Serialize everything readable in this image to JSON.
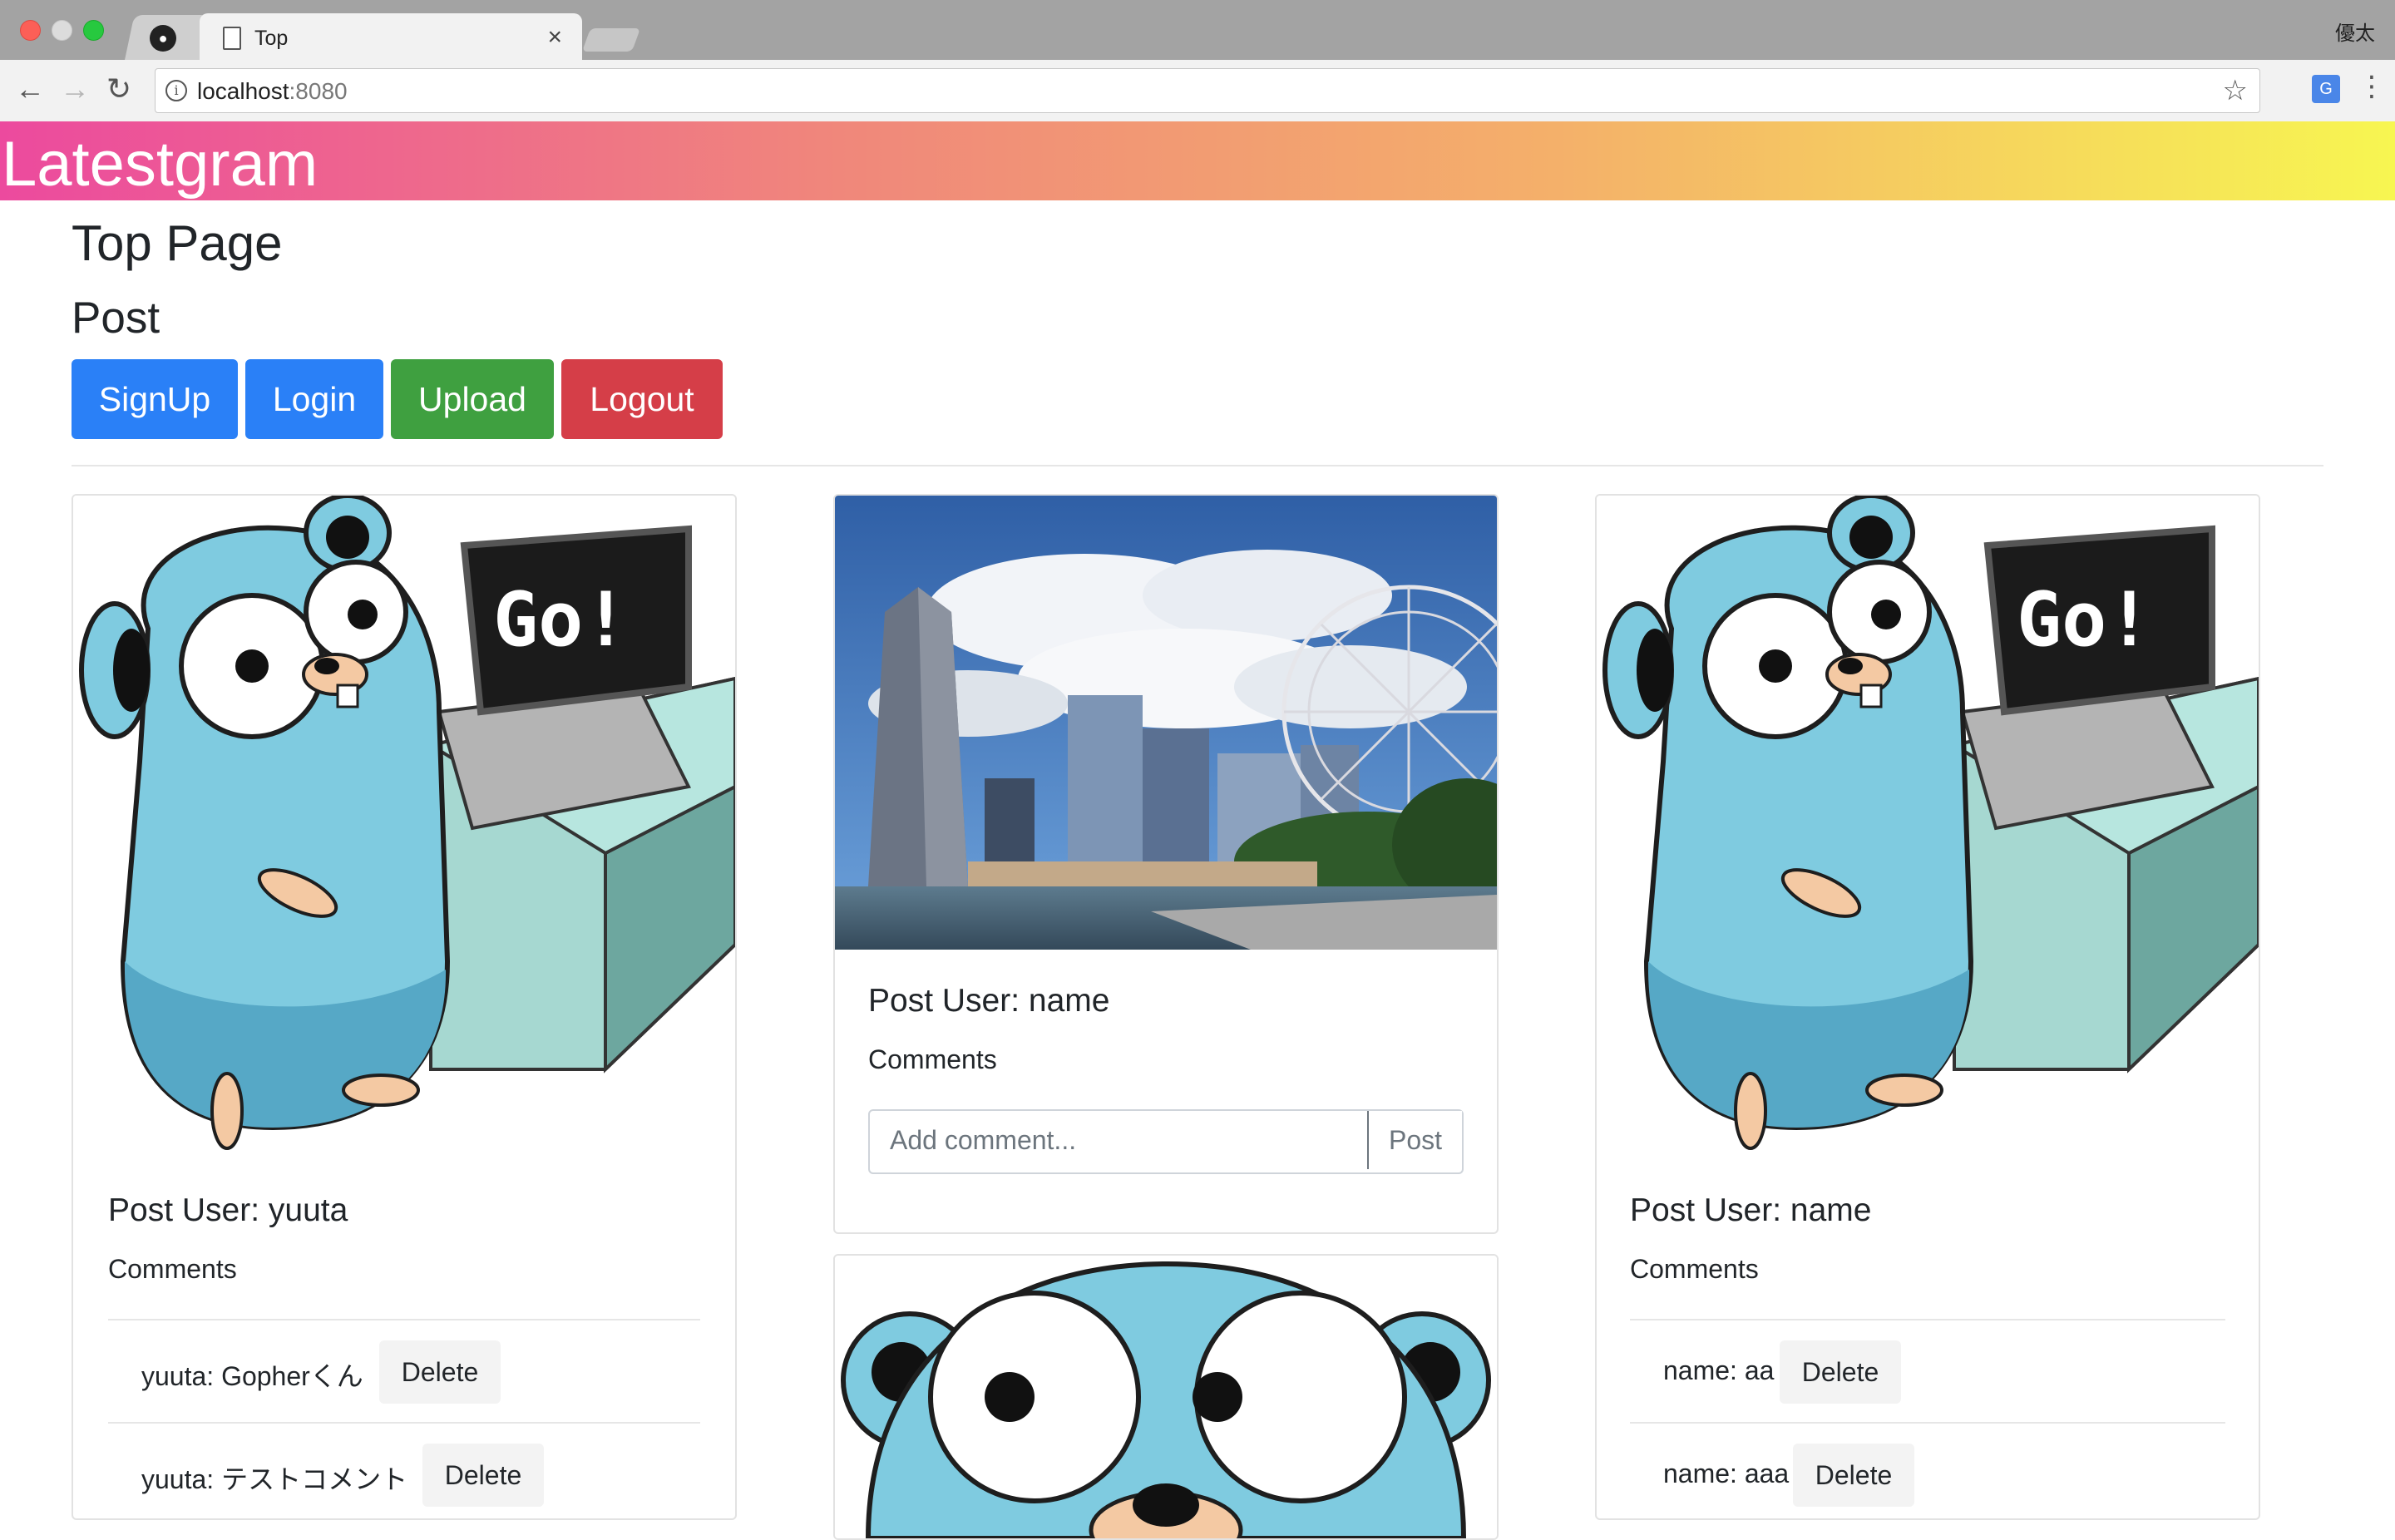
{
  "browser": {
    "tab_title": "Top",
    "tab_close": "×",
    "profile_name": "優太",
    "url_host": "localhost",
    "url_port": ":8080"
  },
  "app": {
    "brand": "Latestgram",
    "page_title": "Top Page",
    "section_title": "Post"
  },
  "actions": {
    "signup": "SignUp",
    "login": "Login",
    "upload": "Upload",
    "logout": "Logout"
  },
  "posts": [
    {
      "user": "Post User: yuuta",
      "comments_label": "Comments",
      "comments": [
        {
          "text": "yuuta: Gopherくん",
          "delete": "Delete"
        },
        {
          "text": "yuuta: テストコメント",
          "delete": "Delete"
        }
      ]
    },
    {
      "user": "Post User: name",
      "comments_label": "Comments",
      "comment_placeholder": "Add comment...",
      "comment_post": "Post"
    },
    {
      "user": "Post User: name",
      "comments_label": "Comments",
      "comments": [
        {
          "text": "name: aa",
          "delete": "Delete"
        },
        {
          "text": "name: aaa",
          "delete": "Delete"
        }
      ]
    }
  ],
  "colors": {
    "primary": "#2a80f7",
    "success": "#3fa040",
    "danger": "#d53e48",
    "brand_gradient_start": "#ec4a9e",
    "brand_gradient_end": "#f7f651"
  },
  "icons": {
    "back": "arrow-left-icon",
    "forward": "arrow-right-icon",
    "reload": "reload-icon",
    "star": "star-icon",
    "menu": "kebab-menu-icon",
    "translate": "translate-icon"
  }
}
